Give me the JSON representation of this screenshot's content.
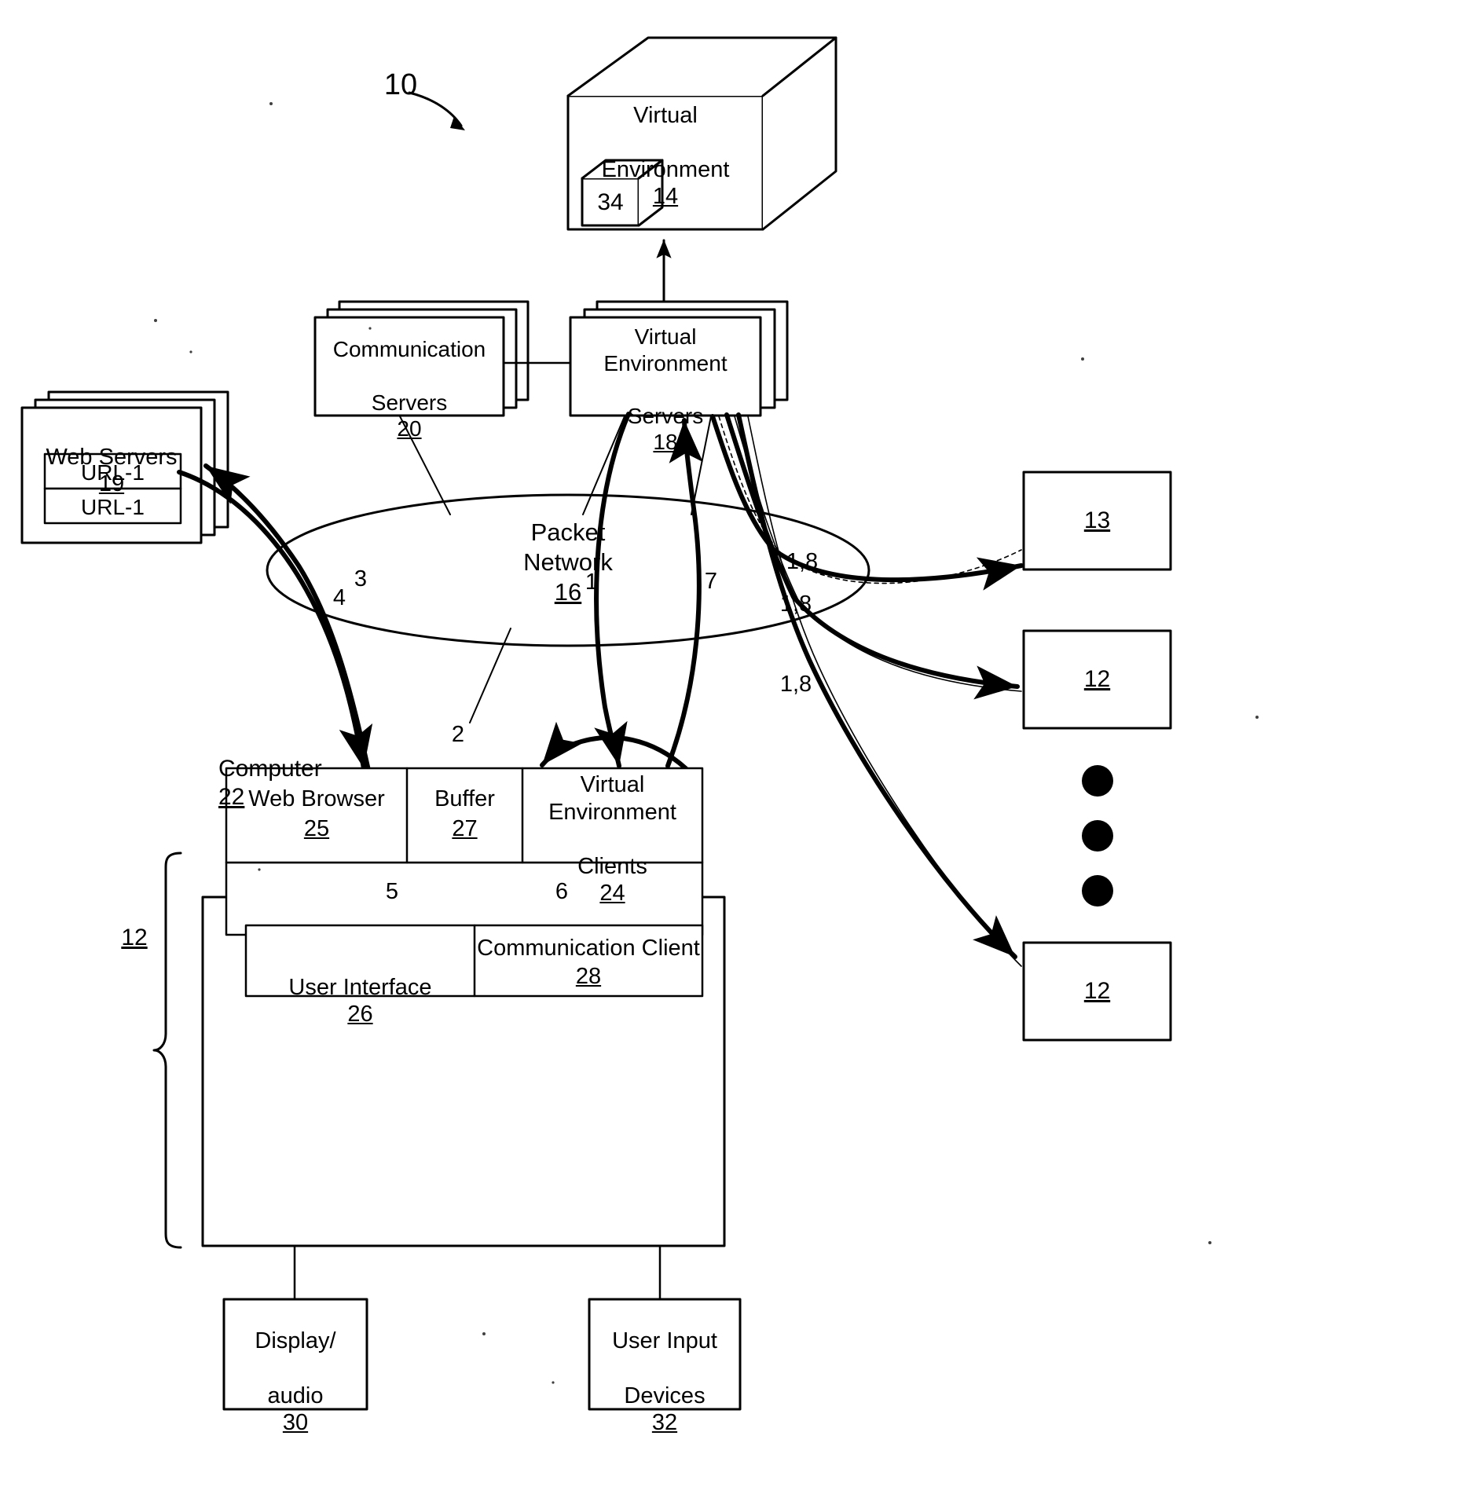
{
  "figure": {
    "reference_numeral": "10",
    "type": "patent-system-block-diagram"
  },
  "virtual_environment_box": {
    "title": "Virtual",
    "title2": "Environment",
    "ref": "14",
    "inner_cube_label": "34"
  },
  "servers": {
    "communication": {
      "line1": "Communication",
      "line2": "Servers",
      "ref": "20"
    },
    "virtual_environment": {
      "line1": "Virtual",
      "line2": "Environment",
      "line3": "Servers",
      "ref": "18"
    },
    "web": {
      "title": "Web  Servers",
      "ref": "19",
      "urls": [
        "URL-1",
        "URL-1"
      ]
    }
  },
  "network": {
    "line1": "Packet",
    "line2": "Network",
    "ref": "16"
  },
  "computer": {
    "title": "Computer",
    "ref": "22",
    "group_ref": "12",
    "modules": [
      {
        "name": "web-browser",
        "line1": "Web Browser",
        "ref": "25"
      },
      {
        "name": "buffer",
        "line1": "Buffer",
        "ref": "27"
      },
      {
        "name": "virtual-environment-clients",
        "line1": "Virtual",
        "line2": "Environment",
        "line3": "Clients",
        "ref": "24"
      }
    ],
    "lower_modules": [
      {
        "name": "user-interface",
        "line1": "User Interface",
        "ref": "26"
      },
      {
        "name": "communication-client",
        "line1": "Communication Client",
        "ref": "28"
      }
    ],
    "peripherals": [
      {
        "name": "display-audio",
        "line1": "Display/",
        "line2": "audio",
        "ref": "30"
      },
      {
        "name": "user-input-devices",
        "line1": "User Input",
        "line2": "Devices",
        "ref": "32"
      }
    ]
  },
  "remote_clients": [
    {
      "ref": "13"
    },
    {
      "ref": "12"
    },
    {
      "ref": "12"
    }
  ],
  "ellipsis_dots": 3,
  "flow_labels": [
    {
      "id": "f1",
      "text": "1"
    },
    {
      "id": "f2",
      "text": "2"
    },
    {
      "id": "f3",
      "text": "3"
    },
    {
      "id": "f4",
      "text": "4"
    },
    {
      "id": "f5",
      "text": "5"
    },
    {
      "id": "f6",
      "text": "6"
    },
    {
      "id": "f7",
      "text": "7"
    },
    {
      "id": "f18a",
      "text": "1,8"
    },
    {
      "id": "f18b",
      "text": "1,8"
    },
    {
      "id": "f18c",
      "text": "1,8"
    }
  ],
  "colors": {
    "ink": "#000000",
    "paper": "#ffffff"
  }
}
